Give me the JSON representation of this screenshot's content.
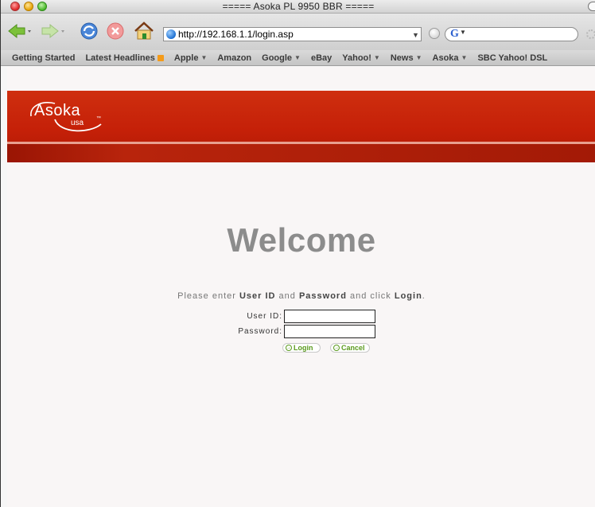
{
  "window": {
    "title": "===== Asoka PL 9950 BBR ====="
  },
  "toolbar": {
    "url": "http://192.168.1.1/login.asp",
    "search_logo": "G"
  },
  "bookmarks": [
    {
      "label": "Getting Started",
      "dropdown": false,
      "rss": false
    },
    {
      "label": "Latest Headlines",
      "dropdown": false,
      "rss": true
    },
    {
      "label": "Apple",
      "dropdown": true,
      "rss": false
    },
    {
      "label": "Amazon",
      "dropdown": false,
      "rss": false
    },
    {
      "label": "Google",
      "dropdown": true,
      "rss": false
    },
    {
      "label": "eBay",
      "dropdown": false,
      "rss": false
    },
    {
      "label": "Yahoo!",
      "dropdown": true,
      "rss": false
    },
    {
      "label": "News",
      "dropdown": true,
      "rss": false
    },
    {
      "label": "Asoka",
      "dropdown": true,
      "rss": false
    },
    {
      "label": "SBC Yahoo! DSL",
      "dropdown": false,
      "rss": false
    }
  ],
  "brand": {
    "logo_text": "Asoka",
    "logo_sub": "usa",
    "logo_tm": "™",
    "header_color": "#c52008"
  },
  "login": {
    "heading": "Welcome",
    "instruction_prefix": "Please enter ",
    "instruction_user": "User ID",
    "instruction_and": " and ",
    "instruction_password": "Password",
    "instruction_click": " and click ",
    "instruction_login": "Login",
    "instruction_end": ".",
    "user_label": "User ID:",
    "password_label": "Password:",
    "user_value": "",
    "password_value": "",
    "login_button": "Login",
    "cancel_button": "Cancel",
    "button_icon": "→"
  }
}
